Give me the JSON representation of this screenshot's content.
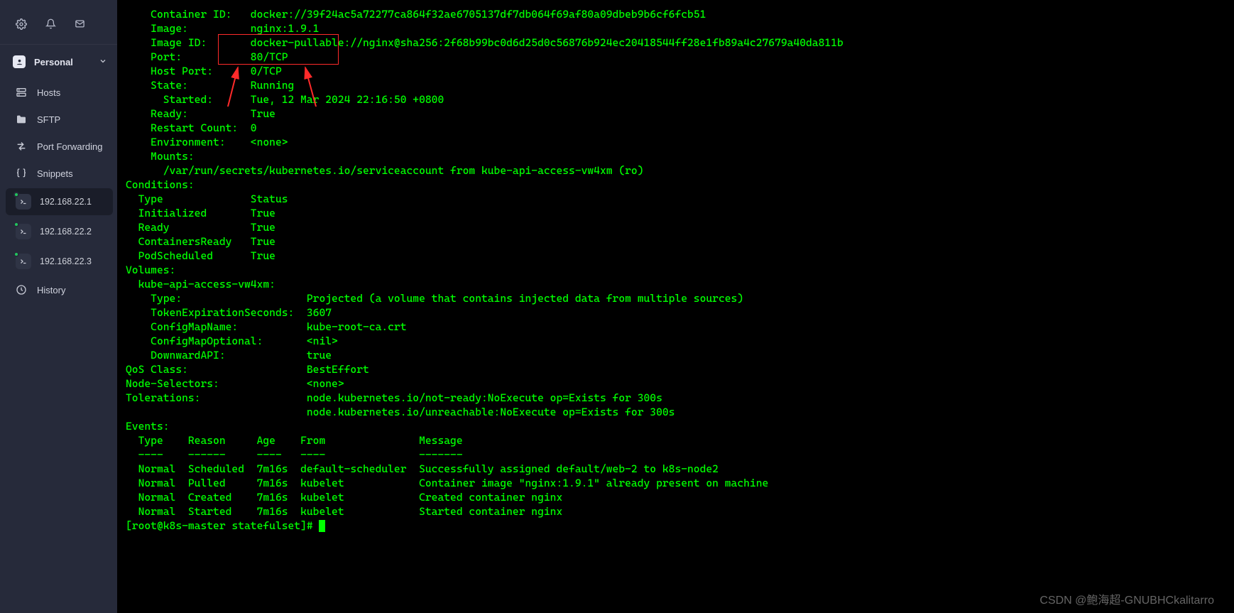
{
  "watermark": "CSDN @鲍海超-GNUBHCkalitarro",
  "sidebar": {
    "workspace_label": "Personal",
    "nav": {
      "hosts": "Hosts",
      "sftp": "SFTP",
      "portfwd": "Port Forwarding",
      "snippets": "Snippets",
      "history": "History"
    },
    "hosts": [
      {
        "ip": "192.168.22.1",
        "selected": true
      },
      {
        "ip": "192.168.22.2",
        "selected": false
      },
      {
        "ip": "192.168.22.3",
        "selected": false
      }
    ]
  },
  "titlebar": {
    "min_sym": "—",
    "max_sym": "▢",
    "close_sym": "✕",
    "collapse_sym": "v"
  },
  "term": {
    "lines": [
      "    Container ID:   docker://39f24ac5a72277ca864f32ae6705137df7db064f69af80a09dbeb9b6cf6fcb51",
      "    Image:          nginx:1.9.1",
      "    Image ID:       docker-pullable://nginx@sha256:2f68b99bc0d6d25d0c56876b924ec20418544ff28e1fb89a4c27679a40da811b",
      "    Port:           80/TCP",
      "    Host Port:      0/TCP",
      "    State:          Running",
      "      Started:      Tue, 12 Mar 2024 22:16:50 +0800",
      "    Ready:          True",
      "    Restart Count:  0",
      "    Environment:    <none>",
      "    Mounts:",
      "      /var/run/secrets/kubernetes.io/serviceaccount from kube-api-access-vw4xm (ro)",
      "Conditions:",
      "  Type              Status",
      "  Initialized       True ",
      "  Ready             True ",
      "  ContainersReady   True ",
      "  PodScheduled      True ",
      "Volumes:",
      "  kube-api-access-vw4xm:",
      "    Type:                    Projected (a volume that contains injected data from multiple sources)",
      "    TokenExpirationSeconds:  3607",
      "    ConfigMapName:           kube-root-ca.crt",
      "    ConfigMapOptional:       <nil>",
      "    DownwardAPI:             true",
      "QoS Class:                   BestEffort",
      "Node-Selectors:              <none>",
      "Tolerations:                 node.kubernetes.io/not-ready:NoExecute op=Exists for 300s",
      "                             node.kubernetes.io/unreachable:NoExecute op=Exists for 300s",
      "Events:",
      "  Type    Reason     Age    From               Message",
      "  ----    ------     ----   ----               -------",
      "  Normal  Scheduled  7m16s  default-scheduler  Successfully assigned default/web-2 to k8s-node2",
      "  Normal  Pulled     7m16s  kubelet            Container image \"nginx:1.9.1\" already present on machine",
      "  Normal  Created    7m16s  kubelet            Created container nginx",
      "  Normal  Started    7m16s  kubelet            Started container nginx"
    ],
    "prompt": "[root@k8s-master statefulset]# "
  }
}
